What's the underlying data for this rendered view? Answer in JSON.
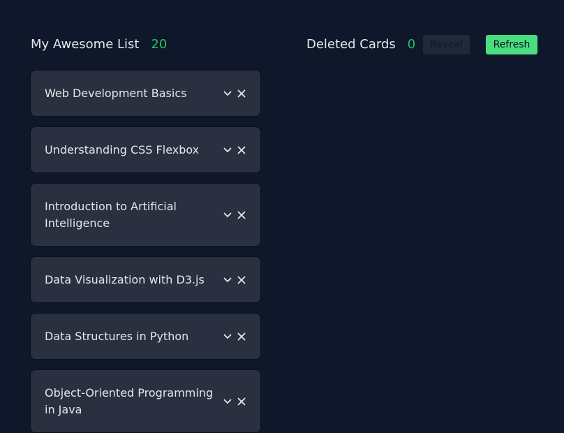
{
  "list": {
    "title": "My Awesome List",
    "count": "20"
  },
  "deleted": {
    "title": "Deleted Cards",
    "count": "0",
    "reveal_label": "Reveal",
    "refresh_label": "Refresh"
  },
  "cards": [
    {
      "title": "Web Development Basics"
    },
    {
      "title": "Understanding CSS Flexbox"
    },
    {
      "title": "Introduction to Artificial Intelligence"
    },
    {
      "title": "Data Visualization with D3.js"
    },
    {
      "title": "Data Structures in Python"
    },
    {
      "title": "Object-Oriented Programming in Java"
    }
  ],
  "colors": {
    "background": "#0f172a",
    "card": "#2b3040",
    "accent": "#22c55e",
    "refresh_button": "#4ade80",
    "reveal_button": "#1f2937"
  },
  "icons": {
    "expand": "chevron-down-icon",
    "delete": "close-icon"
  }
}
